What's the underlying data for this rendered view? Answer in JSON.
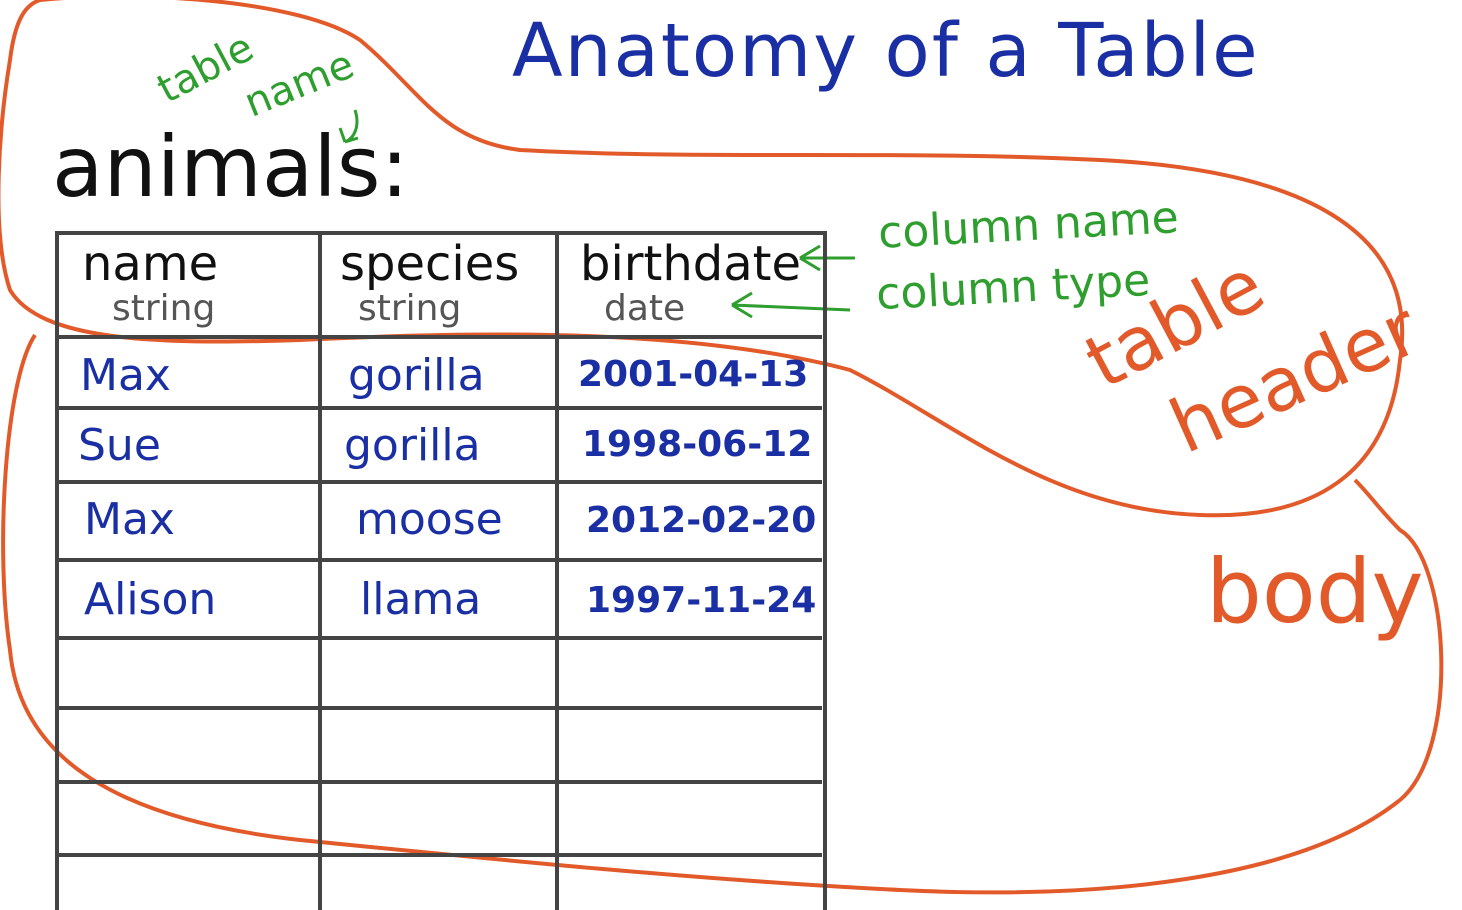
{
  "title": "Anatomy of a Table",
  "table_name": "animals:",
  "annotations": {
    "table_name_line1": "table",
    "table_name_line2": "name",
    "column_name": "column name",
    "column_type": "column type",
    "table": "table",
    "header": "header",
    "body": "body"
  },
  "columns": [
    {
      "name": "name",
      "type": "string"
    },
    {
      "name": "species",
      "type": "string"
    },
    {
      "name": "birthdate",
      "type": "date"
    }
  ],
  "rows": [
    {
      "name": "Max",
      "species": "gorilla",
      "birthdate": "2001-04-13"
    },
    {
      "name": "Sue",
      "species": "gorilla",
      "birthdate": "1998-06-12"
    },
    {
      "name": "Max",
      "species": "moose",
      "birthdate": "2012-02-20"
    },
    {
      "name": "Alison",
      "species": "llama",
      "birthdate": "1997-11-24"
    }
  ],
  "colors": {
    "title": "#1a2fa3",
    "annotation_green": "#2e9e2e",
    "annotation_orange": "#e25a2a",
    "grid": "#444444"
  }
}
